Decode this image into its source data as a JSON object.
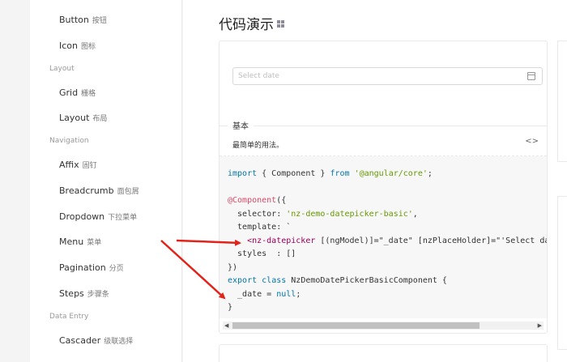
{
  "sidebar": {
    "items": [
      {
        "label": "Button",
        "cn": "按钮"
      },
      {
        "label": "Icon",
        "cn": "图标"
      },
      {
        "group": "Layout"
      },
      {
        "label": "Grid",
        "cn": "栅格"
      },
      {
        "label": "Layout",
        "cn": "布局"
      },
      {
        "group": "Navigation"
      },
      {
        "label": "Affix",
        "cn": "固钉"
      },
      {
        "label": "Breadcrumb",
        "cn": "面包屑"
      },
      {
        "label": "Dropdown",
        "cn": "下拉菜单"
      },
      {
        "label": "Menu",
        "cn": "菜单"
      },
      {
        "label": "Pagination",
        "cn": "分页"
      },
      {
        "label": "Steps",
        "cn": "步骤条"
      },
      {
        "group": "Data Entry"
      },
      {
        "label": "Cascader",
        "cn": "级联选择"
      }
    ]
  },
  "main": {
    "title": "代码演示",
    "demo": {
      "placeholder": "Select date",
      "meta_title": "基本",
      "meta_desc": "最简单的用法。",
      "code_toggle": "<>"
    }
  },
  "code": {
    "l1a": "import",
    "l1b": " { Component } ",
    "l1c": "from",
    "l1d": "'@angular/core'",
    "l1e": ";",
    "l3a": "@Component",
    "l3b": "({",
    "l4a": "  selector: ",
    "l4b": "'nz-demo-datepicker-basic'",
    "l4c": ",",
    "l5a": "  template: `",
    "l6a": "    <nz-datepicker ",
    "l6b": "[(ngModel)]=\"_date\" [nzPlaceHolder]=\"'Select da",
    "l7a": "  styles  : []",
    "l8a": "})",
    "l9a": "export",
    "l9b": " ",
    "l9c": "class",
    "l9d": " NzDemoDatePickerBasicComponent {",
    "l10a": "  _date = ",
    "l10b": "null",
    "l10c": ";",
    "l11a": "}"
  },
  "colors": {
    "arrow": "#e2231a"
  }
}
